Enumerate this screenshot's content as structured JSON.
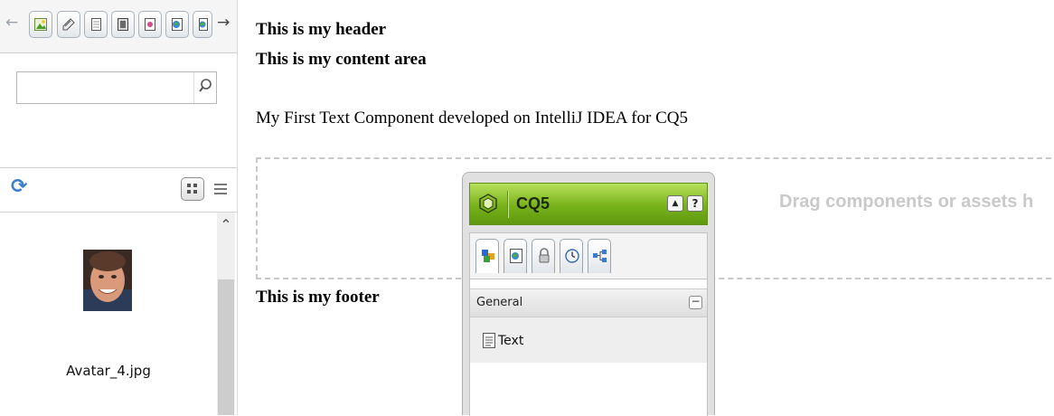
{
  "finder": {
    "tabs": [
      {
        "name": "images-tab",
        "icon": "image-icon"
      },
      {
        "name": "documents-tab",
        "icon": "document-icon"
      },
      {
        "name": "pages-tab",
        "icon": "page-icon"
      },
      {
        "name": "movies-tab",
        "icon": "film-icon"
      },
      {
        "name": "paragraphs-tab",
        "icon": "paragraph-icon"
      },
      {
        "name": "products-tab",
        "icon": "product-icon"
      },
      {
        "name": "sites-tab",
        "icon": "site-icon"
      }
    ],
    "search": {
      "value": "",
      "placeholder": ""
    },
    "asset": {
      "name": "Avatar_4.jpg"
    }
  },
  "page": {
    "header": "This is my header",
    "content": "This is my content area",
    "paragraph": "My First Text Component developed on IntelliJ IDEA for CQ5",
    "drop_hint": "Drag components or assets h",
    "footer": "This is my footer"
  },
  "sidekick": {
    "title": "CQ5",
    "help_label": "?",
    "up_label": "▲",
    "group_label": "General",
    "collapse_label": "−",
    "component_label": "Text"
  },
  "colors": {
    "sidekick_green": "#78b21a",
    "drop_hint_gray": "#c9c9c9",
    "refresh_blue": "#3b7fd0"
  }
}
